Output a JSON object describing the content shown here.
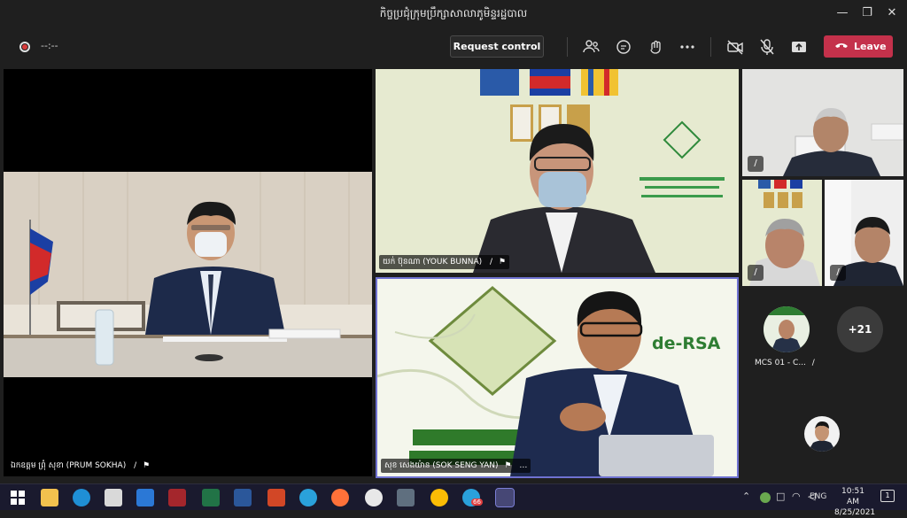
{
  "window": {
    "title": "កិច្ចប្រជុំក្រុមប្រឹក្សាសាលាភូមិន្ទរដ្ឋបាល"
  },
  "toolbar": {
    "timer": "--:--",
    "request_control_label": "Request control",
    "leave_label": "Leave"
  },
  "participants": {
    "main_left": {
      "name": "ឯកឧត្តម ព្រុំ សុខា (PRUM SOKHA)"
    },
    "top_center": {
      "name": "យក់ ប៊ុនណា (YOUK BUNNA)"
    },
    "bottom_center": {
      "name": "សុខ សេងយ៉ាន (SOK SENG YAN)",
      "screen_text": "de-RSA"
    },
    "mcs": {
      "name": "MCS 01 - C..."
    },
    "overflow_count": "+21"
  },
  "taskbar": {
    "language": "ENG",
    "time": "10:51 AM",
    "date": "8/25/2021",
    "notification_count": "1",
    "telegram_badge": "66"
  },
  "colors": {
    "leave": "#c4314b",
    "active_border": "#6f72d1",
    "accent": "#464775"
  }
}
